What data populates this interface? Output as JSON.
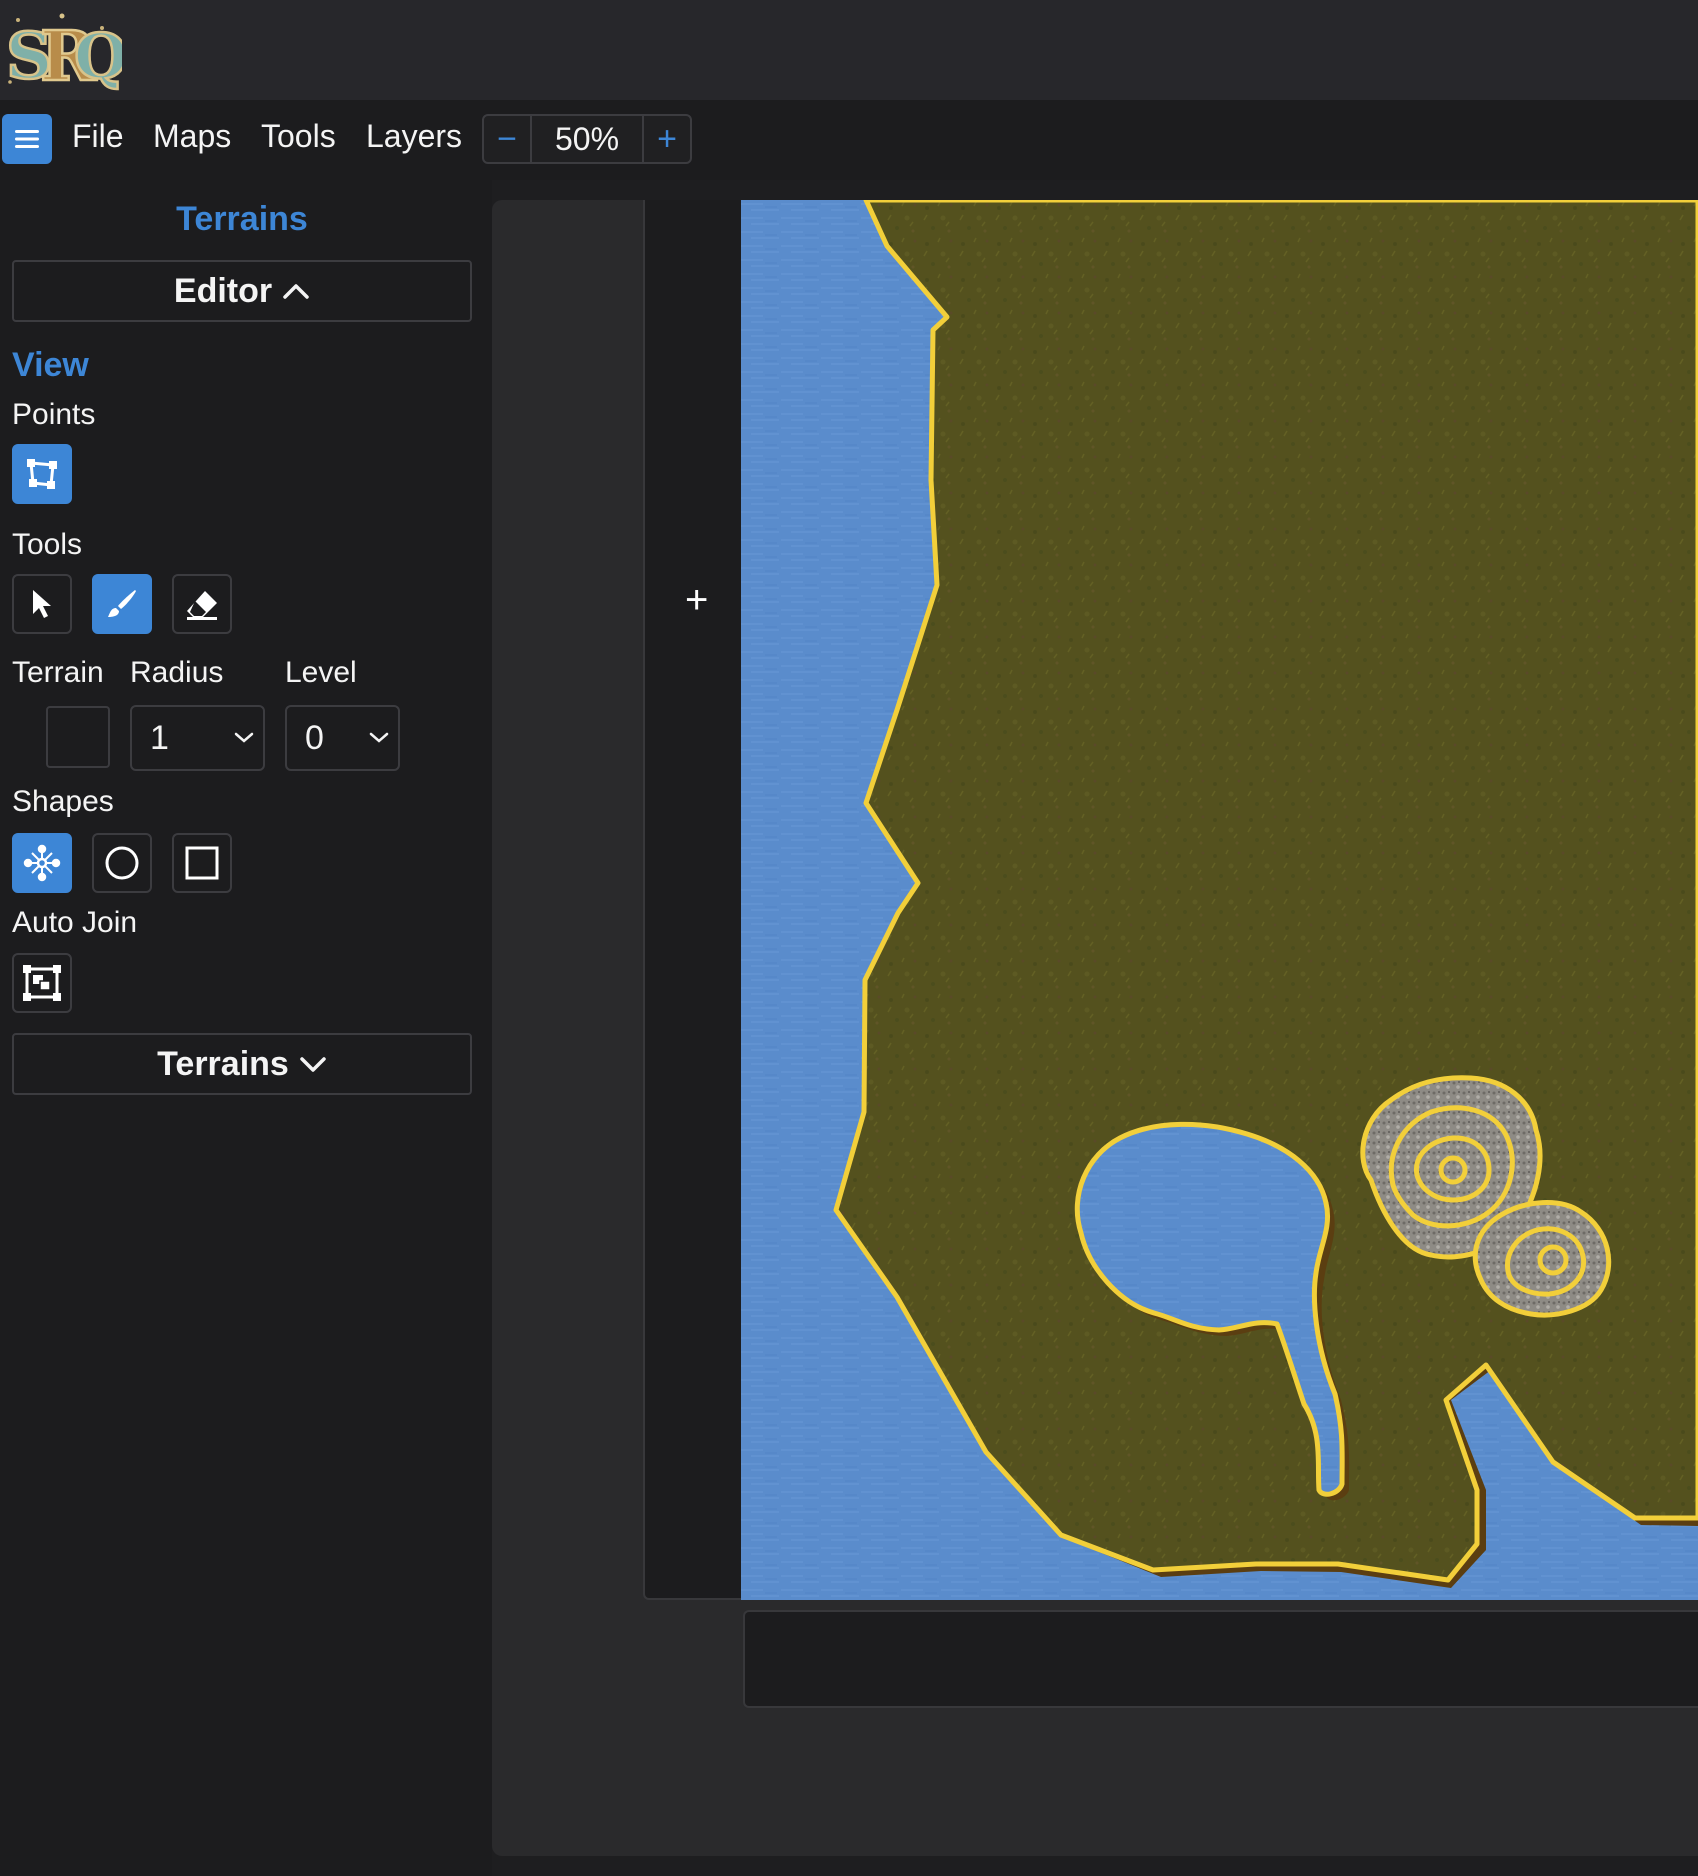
{
  "app": {
    "logo_icon": "srq-logo-icon",
    "accent_color": "#3d86d6"
  },
  "menubar": {
    "menu_icon": "hamburger-icon",
    "items": [
      "File",
      "Maps",
      "Tools",
      "Layers"
    ],
    "zoom": {
      "minus_label": "−",
      "value": "50%",
      "plus_label": "+"
    }
  },
  "sidebar": {
    "title": "Terrains",
    "editor_label": "Editor",
    "editor_state": "expanded",
    "view_heading": "View",
    "points_label": "Points",
    "points_icon": "points-edit-icon",
    "tools_label": "Tools",
    "tools": [
      {
        "icon": "cursor-select-icon",
        "active": false
      },
      {
        "icon": "paint-brush-icon",
        "active": true
      },
      {
        "icon": "eraser-icon",
        "active": false
      }
    ],
    "terrain_label": "Terrain",
    "radius_label": "Radius",
    "radius_value": "1",
    "level_label": "Level",
    "level_value": "0",
    "shapes_label": "Shapes",
    "shapes": [
      {
        "icon": "freeform-shape-icon",
        "active": true
      },
      {
        "icon": "circle-shape-icon",
        "active": false
      },
      {
        "icon": "square-shape-icon",
        "active": false
      }
    ],
    "autojoin_label": "Auto Join",
    "autojoin_icon": "auto-join-icon",
    "terrains_label": "Terrains",
    "terrains_state": "collapsed"
  },
  "canvas": {
    "add_label": "+",
    "terrain_colors": {
      "water": "#5a8ccc",
      "grass": "#54511e",
      "outline": "#f2cf3a",
      "rock": "#8e8b85"
    }
  }
}
